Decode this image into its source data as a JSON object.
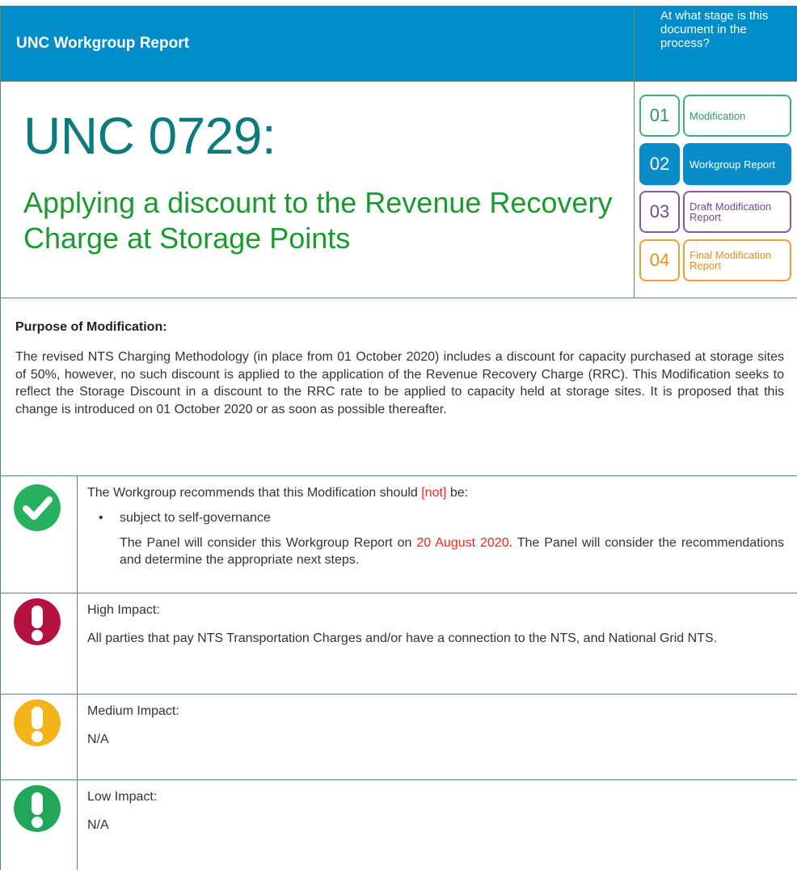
{
  "header": {
    "title": "UNC Workgroup Report",
    "stage_question": "At what stage is this document in the process?"
  },
  "document": {
    "number": "UNC 0729:",
    "subtitle": "Applying a discount to the Revenue Recovery Charge at Storage Points"
  },
  "stages": [
    {
      "num": "01",
      "label": "Modification"
    },
    {
      "num": "02",
      "label": "Workgroup Report"
    },
    {
      "num": "03",
      "label": "Draft Modification Report"
    },
    {
      "num": "04",
      "label": "Final Modification Report"
    }
  ],
  "purpose": {
    "heading": "Purpose of Modification:",
    "text": "The revised NTS Charging Methodology (in place from 01 October 2020) includes a discount for capacity purchased at storage sites of 50%, however, no such discount is applied to the application of the Revenue Recovery Charge (RRC). This Modification seeks to reflect the Storage Discount in a discount to the RRC rate to be applied to capacity held at storage sites. It is proposed that this change is introduced on 01 October 2020 or as soon as possible thereafter."
  },
  "recommendation": {
    "intro_before": "The Workgroup recommends that this Modification should ",
    "intro_flag": "[not]",
    "intro_after": " be:",
    "bullet": "subject to self-governance",
    "panel_before": "The Panel will consider this Workgroup Report on ",
    "panel_date": "20 August 2020",
    "panel_after": ". The Panel will consider the recommendations and determine the appropriate next steps."
  },
  "impacts": {
    "high": {
      "label": "High Impact:",
      "text": "All parties that pay NTS Transportation Charges and/or have a connection to the NTS, and National Grid NTS."
    },
    "medium": {
      "label": "Medium Impact:",
      "text": "N/A"
    },
    "low": {
      "label": "Low Impact:",
      "text": "N/A"
    }
  },
  "colors": {
    "header_blue": "#008dc9",
    "title_teal": "#0c7b7e",
    "subtitle_green": "#1b9a2f",
    "check_green": "#27b05e",
    "high_red": "#b5133f",
    "medium_amber": "#f2b418",
    "low_green": "#21a65a",
    "highlight_red": "#ff1f1f"
  }
}
